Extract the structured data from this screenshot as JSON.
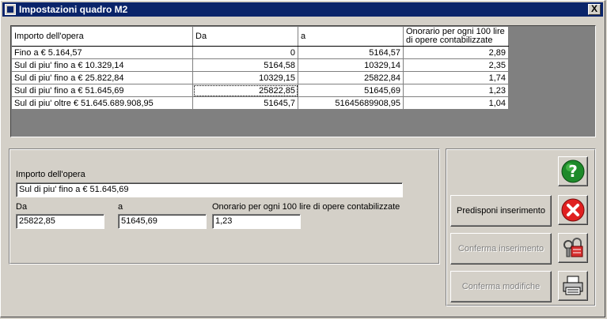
{
  "window": {
    "title": "Impostazioni quadro M2",
    "close_label": "X"
  },
  "grid": {
    "headers": [
      "Importo dell'opera",
      "Da",
      "a",
      "Onorario per ogni 100 lire di opere contabilizzate"
    ],
    "rows": [
      [
        "Fino a € 5.164,57",
        "0",
        "5164,57",
        "2,89"
      ],
      [
        "Sul di piu' fino a € 10.329,14",
        "5164,58",
        "10329,14",
        "2,35"
      ],
      [
        "Sul di piu' fino a € 25.822,84",
        "10329,15",
        "25822,84",
        "1,74"
      ],
      [
        "Sul di piu' fino a € 51.645,69",
        "25822,85",
        "51645,69",
        "1,23"
      ],
      [
        "Sul di piu' oltre € 51.645.689.908,95",
        "51645,7",
        "51645689908,95",
        "1,04"
      ]
    ]
  },
  "form": {
    "importo_label": "Importo dell'opera",
    "importo_value": "Sul di piu' fino a € 51.645,69",
    "da_label": "Da",
    "da_value": "25822,85",
    "a_label": "a",
    "a_value": "51645,69",
    "onorario_label": "Onorario per ogni 100 lire di opere contabilizzate",
    "onorario_value": "1,23"
  },
  "actions": {
    "predisponi": "Predisponi inserimento",
    "conferma_inserimento": "Conferma inserimento",
    "conferma_modifiche": "Conferma modifiche"
  },
  "icons": {
    "help": "help-icon",
    "cancel": "cancel-icon",
    "lock": "lock-icon",
    "print": "printer-icon"
  },
  "colors": {
    "titlebar": "#0a246a",
    "help_green": "#1e8a2a",
    "cancel_red": "#e02020"
  }
}
